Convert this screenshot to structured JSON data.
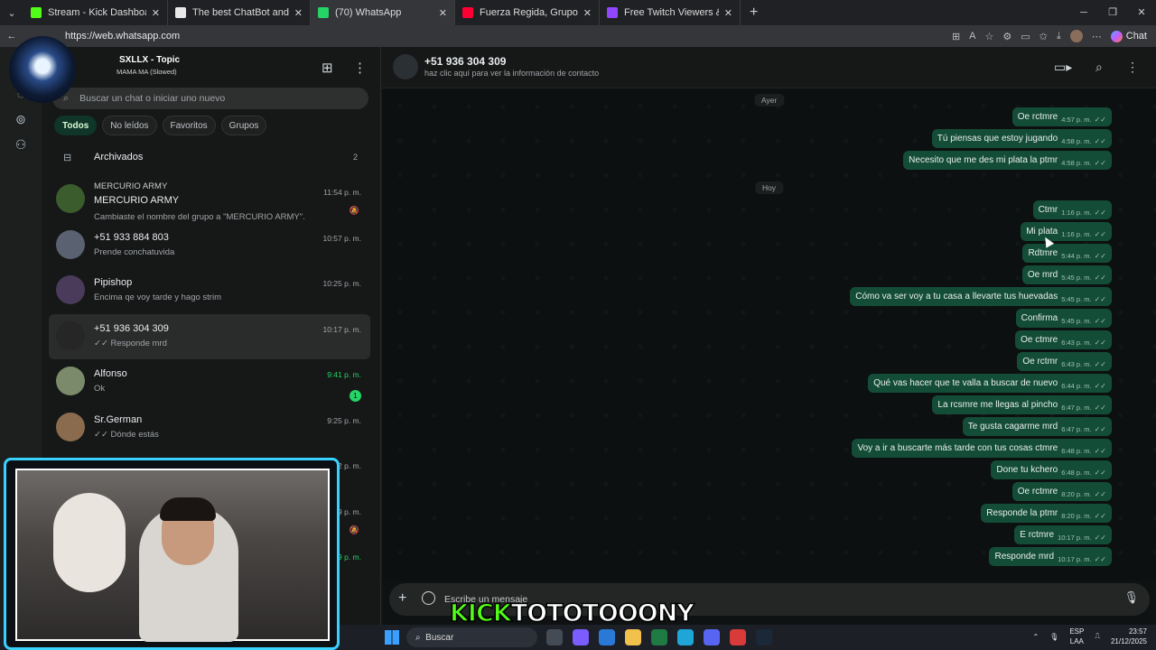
{
  "browser": {
    "tabs": [
      {
        "title": "Stream - Kick Dashboard",
        "color": "#53fc18",
        "active": false
      },
      {
        "title": "The best ChatBot and Widgets for",
        "color": "#e8e8e8",
        "active": false
      },
      {
        "title": "(70) WhatsApp",
        "color": "#25d366",
        "active": true
      },
      {
        "title": "Fuerza Regida, Grupo Frontera - C",
        "color": "#ff0033",
        "active": false
      },
      {
        "title": "Free Twitch Viewers & Free Kick Vi",
        "color": "#9146ff",
        "active": false
      }
    ],
    "url": "https://web.whatsapp.com",
    "chat_label": "Chat"
  },
  "now_playing": {
    "title": "SXLLX - Topic",
    "subtitle": "MAMA MA (Slowed)"
  },
  "sidebar": {
    "search_placeholder": "Buscar un chat o iniciar uno nuevo",
    "filters": [
      "Todos",
      "No leídos",
      "Favoritos",
      "Grupos"
    ],
    "archived_label": "Archivados",
    "archived_count": "2",
    "chats": [
      {
        "group_label": "MERCURIO ARMY",
        "name": "MERCURIO ARMY",
        "preview": "Cambiaste el nombre del grupo a \"MERCURIO ARMY\".",
        "time": "11:54 p. m.",
        "muted": true,
        "avatar_color": "#3b5d2e"
      },
      {
        "name": "+51 933 884 803",
        "preview": "Prende conchatuvida",
        "time": "10:57 p. m.",
        "avatar_color": "#5a6170"
      },
      {
        "name": "Pipishop",
        "preview": "Encima qe voy tarde y hago strim",
        "time": "10:25 p. m.",
        "avatar_color": "#4a3b5a"
      },
      {
        "name": "+51 936 304 309",
        "preview": "✓✓ Responde mrd",
        "time": "10:17 p. m.",
        "selected": true,
        "avatar_color": "#262626"
      },
      {
        "name": "Alfonso",
        "preview": "Ok",
        "time": "9:41 p. m.",
        "unread": "1",
        "time_green": true,
        "avatar_color": "#7a8a6a"
      },
      {
        "name": "Sr.German",
        "preview": "✓✓ Dónde estás",
        "time": "9:25 p. m.",
        "avatar_color": "#8a6b4e"
      },
      {
        "name": "",
        "preview": "",
        "time": "2 p. m.",
        "avatar_color": "#2b3035"
      },
      {
        "name": "",
        "preview": "",
        "time": "9 p. m.",
        "muted": true,
        "avatar_color": "#2b3035"
      },
      {
        "name": "",
        "preview": "",
        "time": "9 p. m.",
        "time_green": true,
        "avatar_color": "#2b3035"
      }
    ]
  },
  "conversation": {
    "contact": "+51 936 304 309",
    "subtitle": "haz clic aquí para ver la información de contacto",
    "day_separators": [
      "Ayer",
      "Hoy"
    ],
    "messages": [
      {
        "text": "Oe rctmre",
        "time": "4:57 p. m."
      },
      {
        "text": "Tú piensas que estoy jugando",
        "time": "4:58 p. m."
      },
      {
        "text": "Necesito que me des mi plata la ptmr",
        "time": "4:58 p. m."
      },
      {
        "text": "Ctmr",
        "time": "1:16 p. m."
      },
      {
        "text": "Mi plata",
        "time": "1:16 p. m."
      },
      {
        "text": "Rdtmre",
        "time": "5:44 p. m."
      },
      {
        "text": "Oe mrd",
        "time": "5:45 p. m."
      },
      {
        "text": "Cómo va ser voy a tu casa a llevarte tus huevadas",
        "time": "5:45 p. m."
      },
      {
        "text": "Confirma",
        "time": "5:45 p. m."
      },
      {
        "text": "Oe ctmre",
        "time": "6:43 p. m."
      },
      {
        "text": "Oe rctmr",
        "time": "6:43 p. m."
      },
      {
        "text": "Qué vas hacer que te valla a buscar de nuevo",
        "time": "6:44 p. m."
      },
      {
        "text": "La rcsmre me llegas al pincho",
        "time": "6:47 p. m."
      },
      {
        "text": "Te gusta cagarme mrd",
        "time": "6:47 p. m."
      },
      {
        "text": "Voy a ir a buscarte más tarde con tus cosas ctmre",
        "time": "6:48 p. m."
      },
      {
        "text": "Done tu kchero",
        "time": "6:48 p. m."
      },
      {
        "text": "Oe rctmre",
        "time": "8:20 p. m."
      },
      {
        "text": "Responde la ptmr",
        "time": "8:20 p. m."
      },
      {
        "text": "E rctmre",
        "time": "10:17 p. m."
      },
      {
        "text": "Responde mrd",
        "time": "10:17 p. m."
      }
    ],
    "composer_placeholder": "Escribe un mensaje"
  },
  "overlay": {
    "kick_a": "KICK",
    "kick_b": "TOTOTOOONY"
  },
  "taskbar": {
    "search_label": "Buscar",
    "lang_top": "ESP",
    "lang_bottom": "LAA",
    "clock_time": "23:57",
    "clock_date": "21/12/2025"
  }
}
